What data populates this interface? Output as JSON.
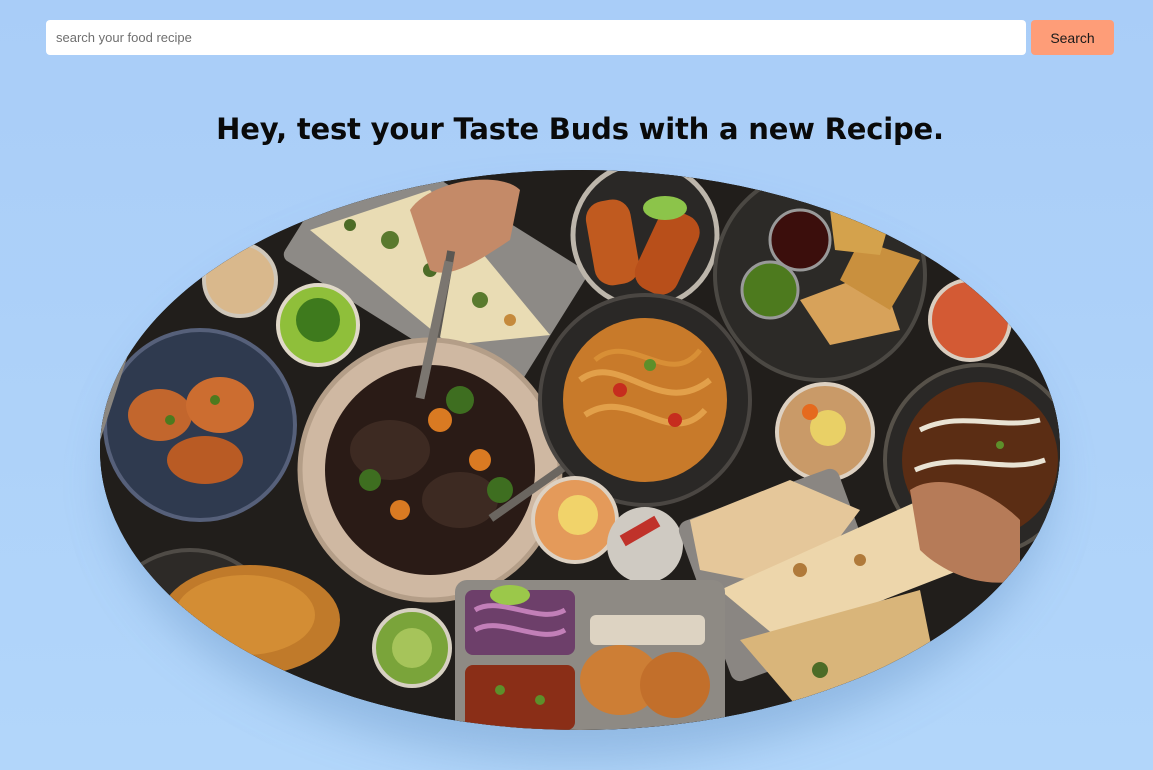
{
  "search": {
    "placeholder": "search your food recipe",
    "value": "",
    "button_label": "Search"
  },
  "colors": {
    "background": "#a9cdf8",
    "button": "#fe9d78",
    "input": "#ffffff"
  },
  "hero": {
    "title": "Hey, test your Taste Buds with a new Recipe.",
    "image": "food-spread-illustration"
  }
}
